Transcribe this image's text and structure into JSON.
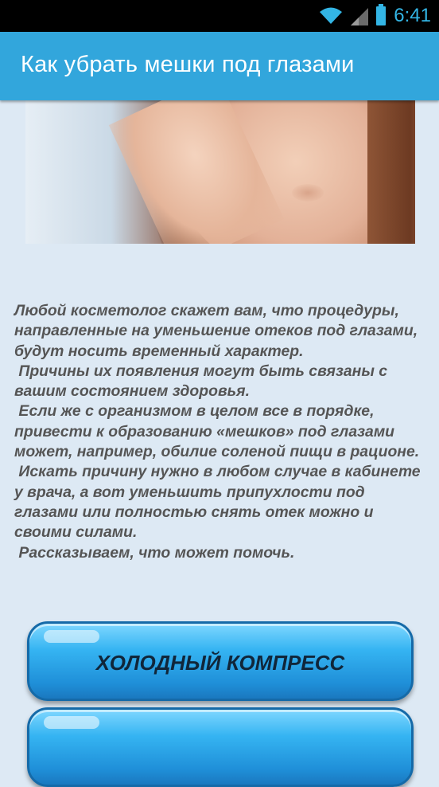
{
  "status_bar": {
    "time": "6:41",
    "icons": [
      "wifi-icon",
      "signal-icon",
      "battery-icon"
    ],
    "accent_color": "#33b5e5"
  },
  "app_bar": {
    "title": "Как убрать мешки под глазами",
    "color": "#32a6dc"
  },
  "hero_image": {
    "description_icon": "woman-face-photo"
  },
  "article": {
    "text": "Любой косметолог скажет вам, что процедуры, направленные на уменьшение отеков под глазами, будут носить временный характер.\n Причины их появления могут быть связаны с вашим состоянием здоровья.\n Если же с организмом в целом все в порядке, привести к образованию «мешков» под глазами может, например, обилие соленой пищи в рационе.\n Искать причину нужно в любом случае в кабинете у врача, а вот уменьшить припухлости под глазами или полностью снять отек можно и своими силами.\n Рассказываем, что может помочь."
  },
  "buttons": [
    {
      "label": "ХОЛОДНЫЙ КОМПРЕСС"
    },
    {
      "label": ""
    }
  ],
  "colors": {
    "background": "#dde9f4",
    "button": "#2aa3e8",
    "text": "#555555"
  }
}
